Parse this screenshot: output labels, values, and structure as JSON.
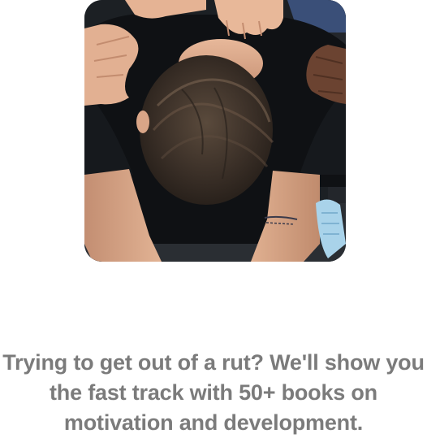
{
  "hero_image": {
    "icon": "photo-people-laying-hands-on-man"
  },
  "caption": {
    "text": "Trying to get out of a rut? We'll show you the fast track with 50+ books on motivation and development."
  }
}
